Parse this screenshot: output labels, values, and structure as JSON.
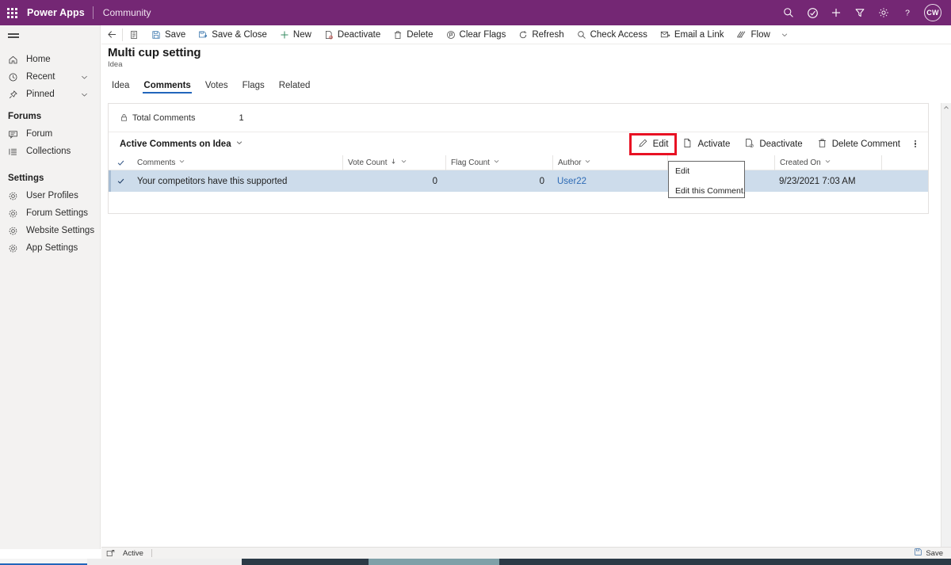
{
  "topbar": {
    "waffle_name": "app-launcher-icon",
    "brand": "Power Apps",
    "environment": "Community",
    "icons": [
      {
        "name": "search-icon",
        "label": "Search"
      },
      {
        "name": "assistant-icon",
        "label": "Assistant"
      },
      {
        "name": "plus-icon",
        "label": "Quick create"
      },
      {
        "name": "filter-icon",
        "label": "Filter"
      },
      {
        "name": "gear-icon",
        "label": "Settings"
      },
      {
        "name": "help-icon",
        "label": "Help"
      }
    ],
    "avatar_initials": "CW",
    "brand_color": "#742774"
  },
  "sidebar": {
    "hamburger_label": "Site map",
    "items": [
      {
        "label": "Home",
        "icon": "home-icon",
        "chevron": false
      },
      {
        "label": "Recent",
        "icon": "clock-icon",
        "chevron": true
      },
      {
        "label": "Pinned",
        "icon": "pin-icon",
        "chevron": true
      }
    ],
    "groups": [
      {
        "title": "Forums",
        "items": [
          {
            "label": "Forum",
            "icon": "forum-icon"
          },
          {
            "label": "Collections",
            "icon": "collections-icon"
          }
        ]
      },
      {
        "title": "Settings",
        "items": [
          {
            "label": "User Profiles",
            "icon": "gear-icon"
          },
          {
            "label": "Forum Settings",
            "icon": "gear-icon"
          },
          {
            "label": "Website Settings",
            "icon": "gear-icon"
          },
          {
            "label": "App Settings",
            "icon": "gear-icon"
          }
        ]
      }
    ]
  },
  "commandbar": {
    "back_label": "Back",
    "form_selector_label": "Form selector",
    "buttons": [
      {
        "label": "Save",
        "icon": "save-icon"
      },
      {
        "label": "Save & Close",
        "icon": "save-close-icon"
      },
      {
        "label": "New",
        "icon": "plus-icon"
      },
      {
        "label": "Deactivate",
        "icon": "deactivate-icon"
      },
      {
        "label": "Delete",
        "icon": "trash-icon"
      },
      {
        "label": "Clear Flags",
        "icon": "clear-flags-icon"
      },
      {
        "label": "Refresh",
        "icon": "refresh-icon"
      },
      {
        "label": "Check Access",
        "icon": "check-access-icon"
      },
      {
        "label": "Email a Link",
        "icon": "email-link-icon"
      },
      {
        "label": "Flow",
        "icon": "flow-icon"
      }
    ],
    "flow_chevron": "chevron-down-icon"
  },
  "record": {
    "title": "Multi cup setting",
    "subtitle": "Idea",
    "tabs": [
      {
        "label": "Idea",
        "active": false
      },
      {
        "label": "Comments",
        "active": true
      },
      {
        "label": "Votes",
        "active": false
      },
      {
        "label": "Flags",
        "active": false
      },
      {
        "label": "Related",
        "active": false
      }
    ],
    "tab_accent_color": "#2266bb"
  },
  "subgrid": {
    "total_label": "Total Comments",
    "total_value": "1",
    "total_icon": "lock-icon",
    "view_name": "Active Comments on Idea",
    "view_chevron": "chevron-down-icon",
    "actions": [
      {
        "label": "Edit",
        "icon": "pencil-icon",
        "highlighted": true
      },
      {
        "label": "Activate",
        "icon": "activate-icon",
        "highlighted": false
      },
      {
        "label": "Deactivate",
        "icon": "deactivate-icon",
        "highlighted": false
      },
      {
        "label": "Delete Comment",
        "icon": "trash-icon",
        "highlighted": false
      }
    ],
    "overflow_label": "More commands",
    "highlight_color": "#e81123",
    "columns": [
      {
        "label": "Comments",
        "sorted": false
      },
      {
        "label": "Vote Count",
        "sorted": true
      },
      {
        "label": "Flag Count",
        "sorted": false
      },
      {
        "label": "Author",
        "sorted": false
      },
      {
        "label": "",
        "sorted": false
      },
      {
        "label": "Created On",
        "sorted": false
      }
    ],
    "rows": [
      {
        "selected": true,
        "comment": "Your competitors have this supported",
        "vote_count": "0",
        "flag_count": "0",
        "author": "User22",
        "blank": "",
        "created_on": "9/23/2021 7:03 AM"
      }
    ],
    "selected_row_color": "#cddceb"
  },
  "tooltip": {
    "title": "Edit",
    "body": "Edit this Comment."
  },
  "statusbar": {
    "state_icon": "record-state-icon",
    "state_label": "Active",
    "save_label": "Save",
    "save_icon": "save-icon"
  }
}
